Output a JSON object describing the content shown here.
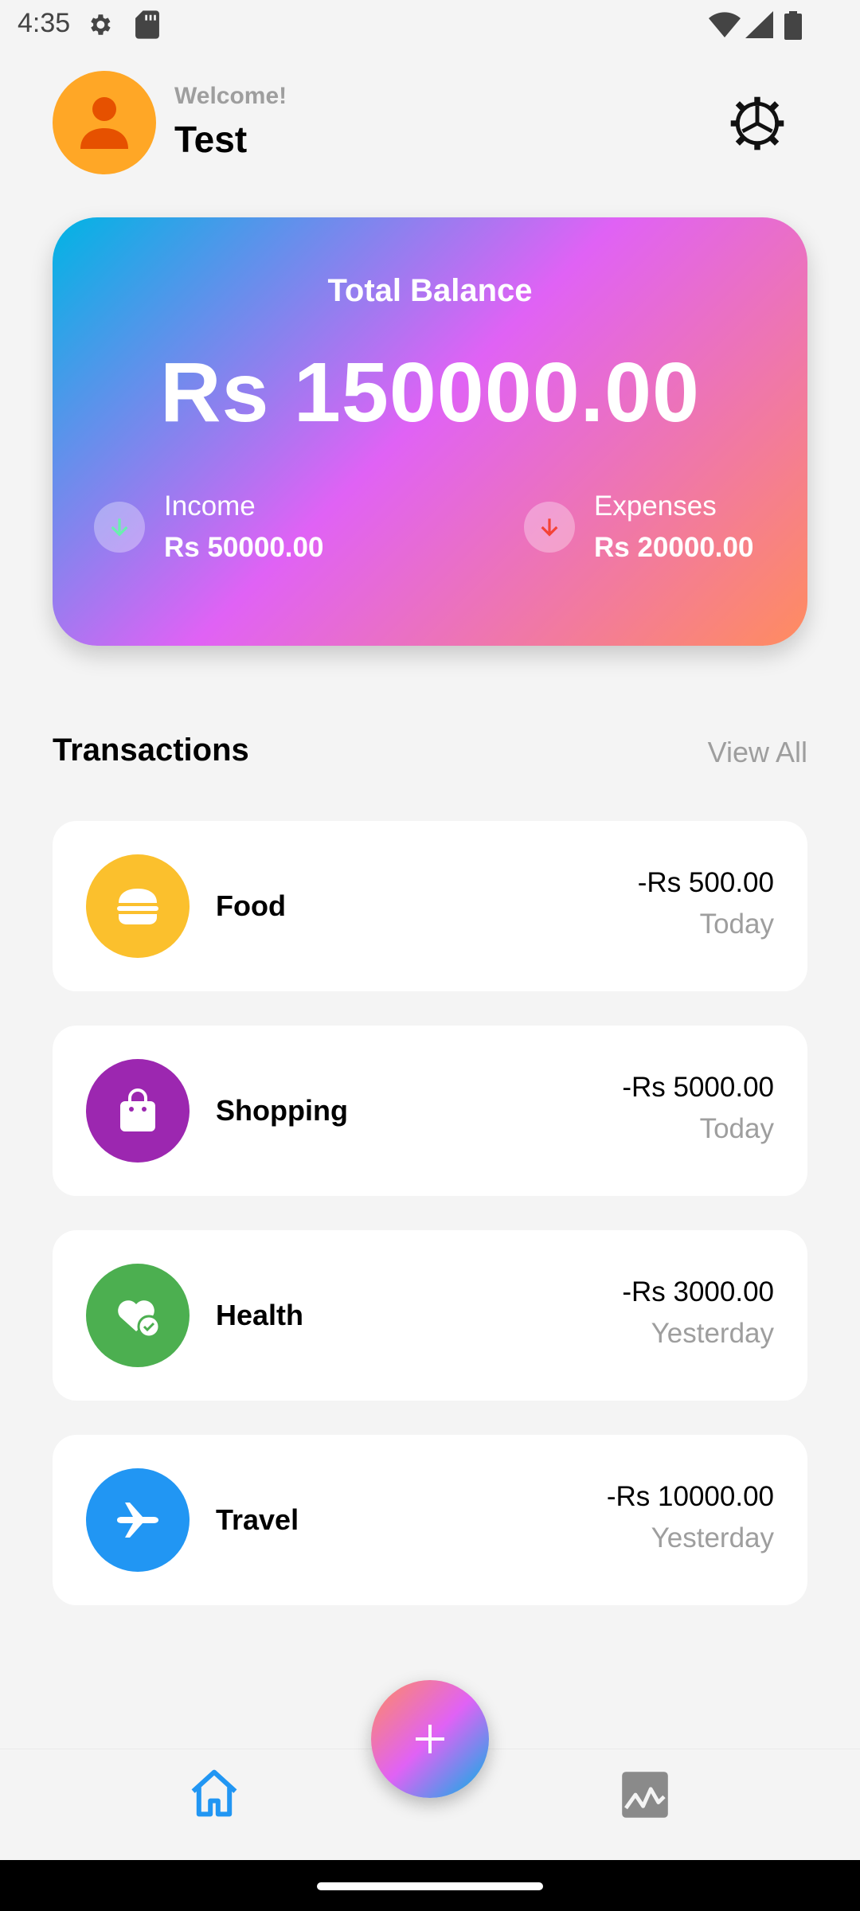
{
  "status_bar": {
    "time": "4:35"
  },
  "header": {
    "welcome": "Welcome!",
    "username": "Test"
  },
  "balance": {
    "title": "Total Balance",
    "amount": "Rs 150000.00",
    "income_label": "Income",
    "income_value": "Rs 50000.00",
    "expenses_label": "Expenses",
    "expenses_value": "Rs 20000.00"
  },
  "transactions": {
    "heading": "Transactions",
    "view_all": "View All",
    "items": [
      {
        "name": "Food",
        "amount": "-Rs 500.00",
        "date": "Today",
        "icon": "burger-icon",
        "color": "#fbc02d"
      },
      {
        "name": "Shopping",
        "amount": "-Rs 5000.00",
        "date": "Today",
        "icon": "shopping-bag-icon",
        "color": "#9c27b0"
      },
      {
        "name": "Health",
        "amount": "-Rs 3000.00",
        "date": "Yesterday",
        "icon": "heart-check-icon",
        "color": "#4caf50"
      },
      {
        "name": "Travel",
        "amount": "-Rs 10000.00",
        "date": "Yesterday",
        "icon": "airplane-icon",
        "color": "#2196f3"
      }
    ]
  },
  "bottom_nav": {
    "active": "home",
    "accent": "#2196f3"
  }
}
